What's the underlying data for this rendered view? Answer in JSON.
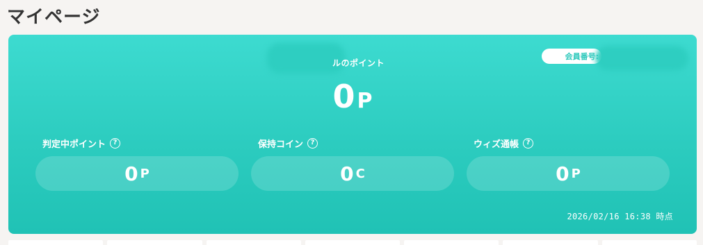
{
  "page": {
    "title": "マイページ"
  },
  "points_card": {
    "main_label": "ルのポイント",
    "main_value": "0",
    "main_unit": "P",
    "member_badge": "会員番号:",
    "stats": [
      {
        "label": "判定中ポイント",
        "value": "0",
        "unit": "P"
      },
      {
        "label": "保持コイン",
        "value": "0",
        "unit": "C"
      },
      {
        "label": "ウィズ通帳",
        "value": "0",
        "unit": "P"
      }
    ],
    "help_glyph": "?",
    "timestamp": "2026/02/16 16:38 時点",
    "colors": {
      "card_top": "#3ddbd0",
      "card_bottom": "#20c2b5",
      "text": "#ffffff"
    }
  }
}
